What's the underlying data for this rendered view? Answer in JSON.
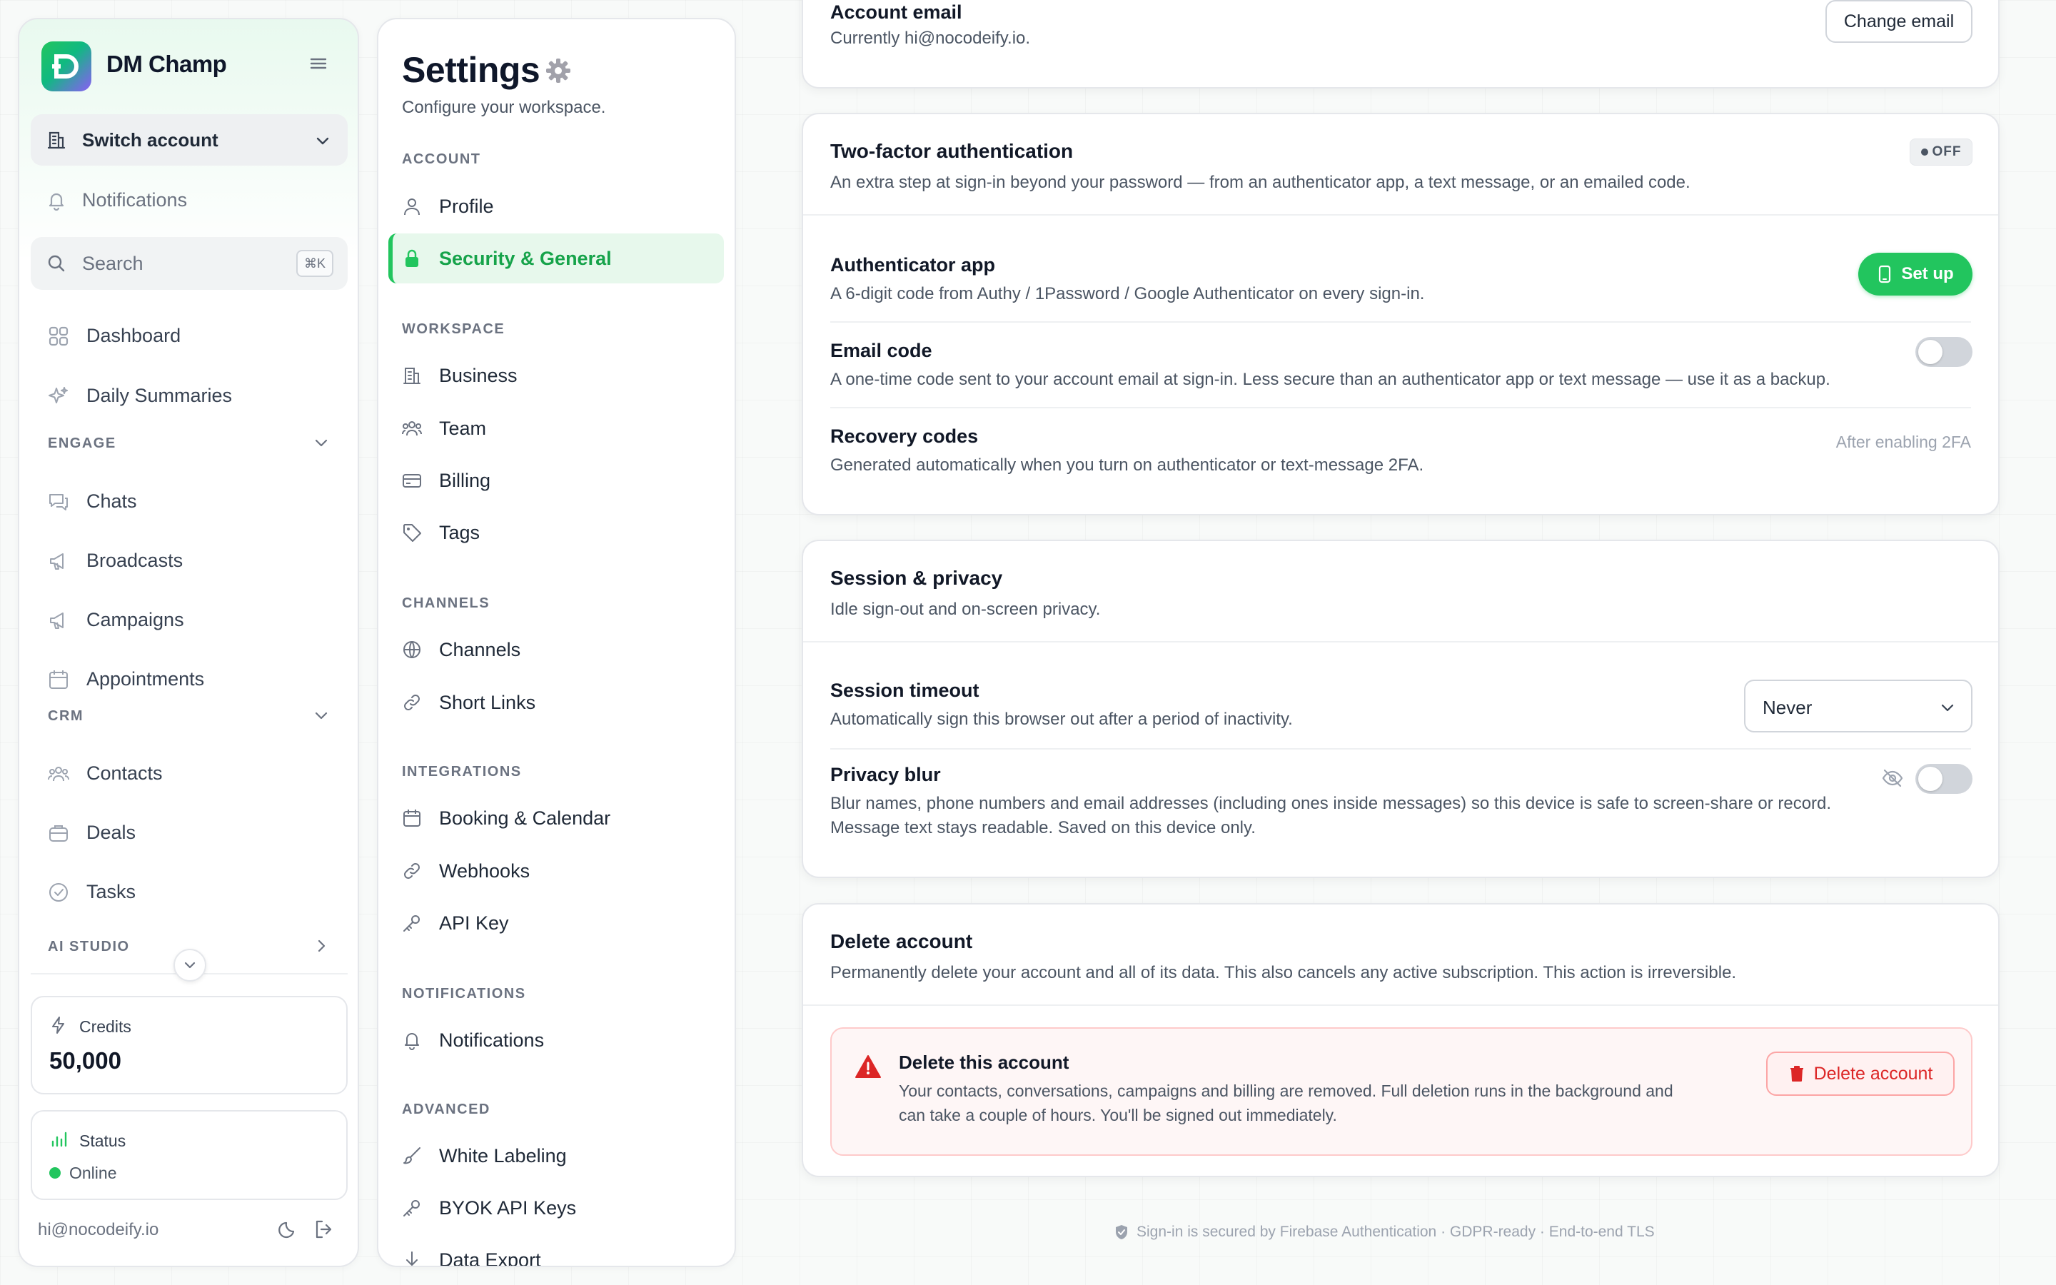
{
  "sidebar": {
    "brand": "DM Champ",
    "switch_account": "Switch account",
    "notifications": "Notifications",
    "search": {
      "placeholder": "Search",
      "shortcut": "⌘K"
    },
    "items_top": [
      {
        "label": "Dashboard",
        "icon": "grid-icon"
      },
      {
        "label": "Daily Summaries",
        "icon": "sparkles-icon"
      }
    ],
    "engage": {
      "heading": "ENGAGE",
      "items": [
        {
          "label": "Chats",
          "icon": "chat-icon"
        },
        {
          "label": "Broadcasts",
          "icon": "megaphone-icon"
        },
        {
          "label": "Campaigns",
          "icon": "megaphone-icon"
        },
        {
          "label": "Appointments",
          "icon": "calendar-icon"
        }
      ]
    },
    "crm": {
      "heading": "CRM",
      "items": [
        {
          "label": "Contacts",
          "icon": "users-icon"
        },
        {
          "label": "Deals",
          "icon": "briefcase-icon"
        },
        {
          "label": "Tasks",
          "icon": "check-circle-icon"
        }
      ]
    },
    "ai_studio": {
      "heading": "AI STUDIO"
    },
    "credits": {
      "label": "Credits",
      "value": "50,000"
    },
    "status": {
      "label": "Status",
      "value": "Online",
      "color": "#22c55e"
    },
    "user_email": "hi@nocodeify.io"
  },
  "settings_nav": {
    "title": "Settings",
    "subtitle": "Configure your workspace.",
    "sections": {
      "account": "ACCOUNT",
      "workspace": "WORKSPACE",
      "channels": "CHANNELS",
      "integrations": "INTEGRATIONS",
      "notifications": "NOTIFICATIONS",
      "advanced": "ADVANCED"
    },
    "items": {
      "profile": "Profile",
      "security": "Security & General",
      "business": "Business",
      "team": "Team",
      "billing": "Billing",
      "tags": "Tags",
      "channels": "Channels",
      "short_links": "Short Links",
      "booking": "Booking & Calendar",
      "webhooks": "Webhooks",
      "api_key": "API Key",
      "notifications": "Notifications",
      "white_labeling": "White Labeling",
      "byok": "BYOK API Keys",
      "data_export": "Data Export"
    },
    "accent": "#22c55e"
  },
  "account_email": {
    "title": "Account email",
    "current": "Currently hi@nocodeify.io.",
    "button": "Change email"
  },
  "two_factor": {
    "title": "Two-factor authentication",
    "description": "An extra step at sign-in beyond your password — from an authenticator app, a text message, or an emailed code.",
    "badge": "OFF",
    "authenticator": {
      "title": "Authenticator app",
      "description": "A 6-digit code from Authy / 1Password / Google Authenticator on every sign-in.",
      "button": "Set up"
    },
    "email_code": {
      "title": "Email code",
      "description": "A one-time code sent to your account email at sign-in. Less secure than an authenticator app or text message — use it as a backup.",
      "enabled": false
    },
    "recovery": {
      "title": "Recovery codes",
      "description": "Generated automatically when you turn on authenticator or text-message 2FA.",
      "note": "After enabling 2FA"
    }
  },
  "session": {
    "title": "Session & privacy",
    "description": "Idle sign-out and on-screen privacy.",
    "timeout": {
      "title": "Session timeout",
      "description": "Automatically sign this browser out after a period of inactivity.",
      "value": "Never"
    },
    "privacy_blur": {
      "title": "Privacy blur",
      "description_line1": "Blur names, phone numbers and email addresses (including ones inside messages) so this device is safe to screen-share or record.",
      "description_line2": "Message text stays readable. Saved on this device only.",
      "enabled": false
    }
  },
  "delete": {
    "title": "Delete account",
    "description": "Permanently delete your account and all of its data. This also cancels any active subscription. This action is irreversible.",
    "box_title": "Delete this account",
    "box_line1": "Your contacts, conversations, campaigns and billing are removed. Full deletion runs in the background and",
    "box_line2": "can take a couple of hours. You'll be signed out immediately.",
    "button": "Delete account",
    "danger_color": "#dc2626"
  },
  "footer": "Sign-in is secured by Firebase Authentication · GDPR-ready · End-to-end TLS"
}
